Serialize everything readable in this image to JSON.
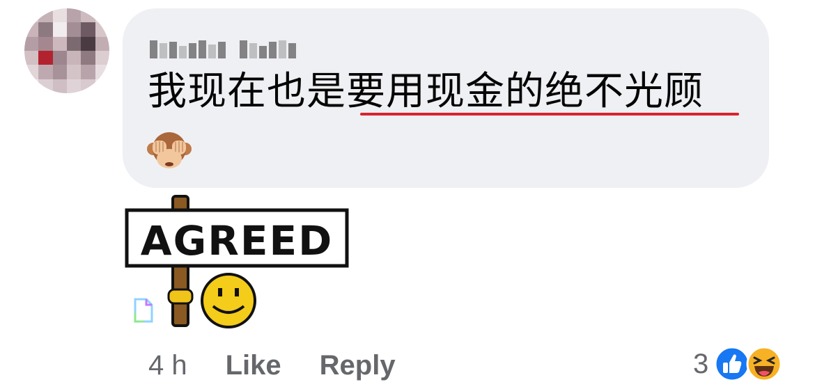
{
  "comment": {
    "author_name": "",
    "text": "我现在也是要用现金的绝不光顾",
    "emoji_icon": "see-no-evil-monkey",
    "sticker_text": "AGREED",
    "sticker_icon": "agreed-sign-smiley-sticker"
  },
  "actions": {
    "timestamp": "4 h",
    "like_label": "Like",
    "reply_label": "Reply"
  },
  "reactions": {
    "count": "3",
    "types": [
      "like",
      "haha"
    ],
    "like_color": "#1877f2",
    "haha_color": "#f7b125"
  },
  "colors": {
    "bubble": "#eff0f3",
    "text": "#050505",
    "meta": "#65676b",
    "spellcheck_underline": "#d9232e"
  }
}
